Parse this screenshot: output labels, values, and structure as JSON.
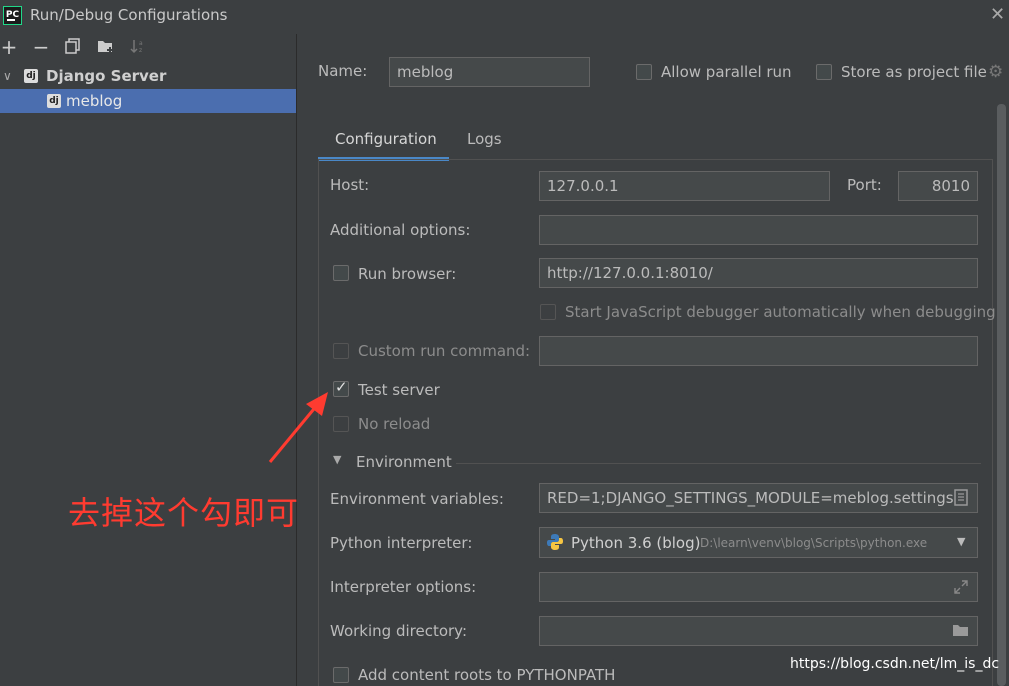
{
  "window": {
    "title": "Run/Debug Configurations",
    "logo_text": "PC"
  },
  "toolbar": {
    "add": "+",
    "remove": "−"
  },
  "tree": {
    "group_label": "Django Server",
    "group_icon_text": "dj",
    "item_label": "meblog",
    "item_icon_text": "dj"
  },
  "header": {
    "name_label": "Name:",
    "name_value": "meblog",
    "allow_parallel_label": "Allow parallel run",
    "store_project_label": "Store as project file"
  },
  "tabs": [
    {
      "label": "Configuration",
      "active": true
    },
    {
      "label": "Logs",
      "active": false
    }
  ],
  "form": {
    "host_label": "Host:",
    "host_value": "127.0.0.1",
    "port_label": "Port:",
    "port_value": "8010",
    "additional_options_label": "Additional options:",
    "additional_options_value": "",
    "run_browser_label": "Run browser:",
    "run_browser_url": "http://127.0.0.1:8010/",
    "js_debugger_label": "Start JavaScript debugger automatically when debugging",
    "custom_run_label": "Custom run command:",
    "custom_run_value": "",
    "test_server_label": "Test server",
    "no_reload_label": "No reload",
    "environment_label": "Environment",
    "env_vars_label": "Environment variables:",
    "env_vars_value": "RED=1;DJANGO_SETTINGS_MODULE=meblog.settings",
    "python_interpreter_label": "Python interpreter:",
    "python_interpreter_value": "Python 3.6 (blog)",
    "python_interpreter_path": "D:\\learn\\venv\\blog\\Scripts\\python.exe",
    "interpreter_options_label": "Interpreter options:",
    "working_dir_label": "Working directory:",
    "add_content_roots_label": "Add content roots to PYTHONPATH"
  },
  "state": {
    "allow_parallel": false,
    "store_project": false,
    "run_browser": false,
    "test_server": true
  },
  "annotation": {
    "text": "去掉这个勾即可",
    "color": "#ff3b30"
  },
  "watermark": "https://blog.csdn.net/lm_is_dc",
  "colors": {
    "background": "#3c3f41",
    "selection": "#4b6eaf",
    "accent": "#4a88c7"
  }
}
